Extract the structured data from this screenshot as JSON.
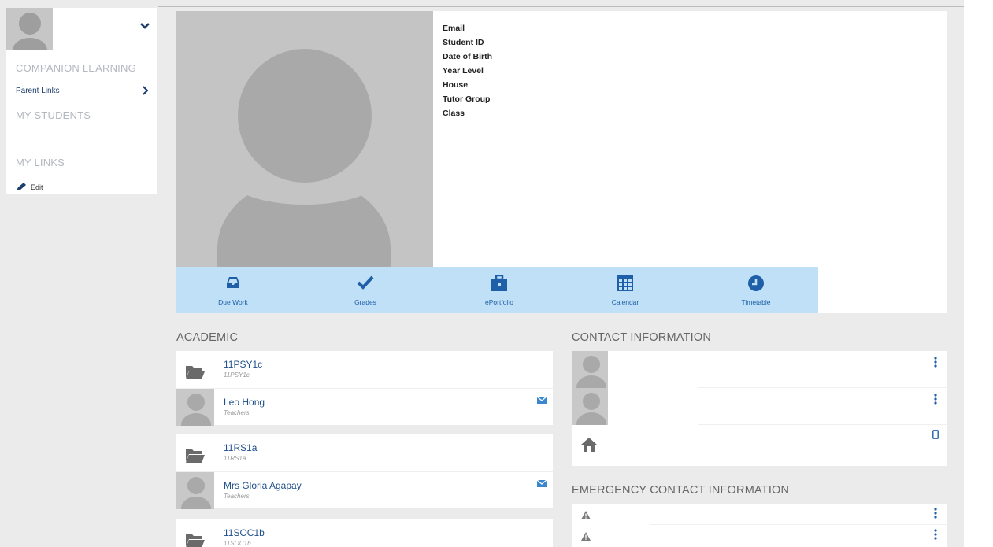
{
  "sidebar": {
    "section_companion": "COMPANION LEARNING",
    "parent_links_label": "Parent Links",
    "section_my_students": "MY STUDENTS",
    "section_my_links": "MY LINKS",
    "edit_label": "Edit"
  },
  "profile": {
    "fields": [
      "Email",
      "Student ID",
      "Date of Birth",
      "Year Level",
      "House",
      "Tutor Group",
      "Class"
    ]
  },
  "quickbar": {
    "items": [
      {
        "label": "Due Work",
        "icon": "inbox-icon"
      },
      {
        "label": "Grades",
        "icon": "checkmark-icon"
      },
      {
        "label": "ePortfolio",
        "icon": "briefcase-icon"
      },
      {
        "label": "Calendar",
        "icon": "calendar-icon"
      },
      {
        "label": "Timetable",
        "icon": "clock-icon"
      }
    ]
  },
  "academic": {
    "heading": "ACADEMIC",
    "classes": [
      {
        "code": "11PSY1c",
        "sub": "11PSY1c",
        "teacher": "Leo Hong",
        "teacher_role": "Teachers"
      },
      {
        "code": "11RS1a",
        "sub": "11RS1a",
        "teacher": "Mrs Gloria Agapay",
        "teacher_role": "Teachers"
      },
      {
        "code": "11SOC1b",
        "sub": "11SOC1b"
      }
    ]
  },
  "contact": {
    "heading": "CONTACT INFORMATION"
  },
  "emergency": {
    "heading": "EMERGENCY CONTACT INFORMATION"
  },
  "colors": {
    "accent_blue": "#1f5fa8",
    "quickbar_bg": "#bfe0f6",
    "page_bg": "#ebebeb"
  }
}
